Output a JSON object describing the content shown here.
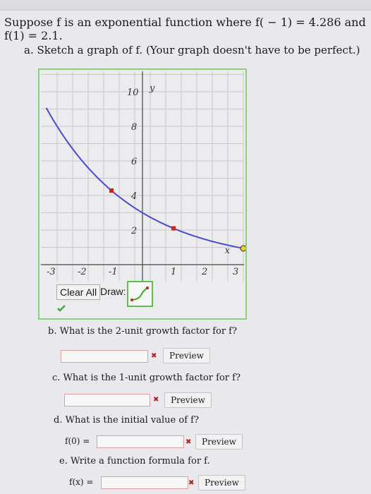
{
  "question": "Suppose f is an exponential function where f( − 1) = 4.286 and f(1) = 2.1.",
  "part_a": "a. Sketch a graph of f. (Your graph doesn't have to be perfect.)",
  "graph": {
    "x_ticks": [
      "-3",
      "-2",
      "-1",
      "1",
      "2",
      "3"
    ],
    "y_ticks": [
      "2",
      "4",
      "6",
      "8",
      "10"
    ],
    "x_axis_label": "x",
    "y_axis_label": "y",
    "points": [
      {
        "x": -1,
        "y": 4.286
      },
      {
        "x": 1,
        "y": 2.1
      }
    ],
    "curve_color": "#4a4ad0",
    "point_color": "#d02020"
  },
  "controls": {
    "clear_all": "Clear All",
    "draw_label": "Draw:"
  },
  "part_b": {
    "question": "b. What is the 2-unit growth factor for f?",
    "value": "",
    "preview": "Preview"
  },
  "part_c": {
    "question": "c. What is the 1-unit growth factor for f?",
    "value": "",
    "preview": "Preview"
  },
  "part_d": {
    "question": "d. What is the initial value of f?",
    "label": "f(0) =",
    "value": "",
    "preview": "Preview"
  },
  "part_e": {
    "question": "e. Write a function formula for f.",
    "label": "f(x) =",
    "value": "",
    "preview": "Preview"
  }
}
